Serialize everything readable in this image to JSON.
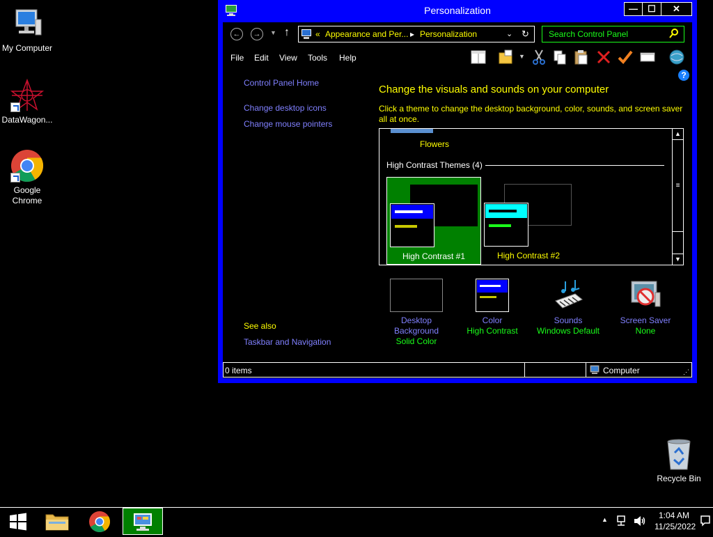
{
  "desktop": {
    "icons": [
      {
        "label": "My Computer"
      },
      {
        "label": "DataWagon..."
      },
      {
        "label": "Google Chrome"
      },
      {
        "label": "Recycle Bin"
      }
    ]
  },
  "window": {
    "title": "Personalization",
    "controls": {
      "minimize": "—",
      "maximize": "☐",
      "close": "✕"
    },
    "breadcrumb": {
      "prefix": "«",
      "parent": "Appearance and Per...",
      "separator": "▸",
      "current": "Personalization"
    },
    "search_placeholder": "Search Control Panel",
    "menu": [
      "File",
      "Edit",
      "View",
      "Tools",
      "Help"
    ],
    "left_links": [
      "Control Panel Home",
      "Change desktop icons",
      "Change mouse pointers"
    ],
    "see_also": {
      "heading": "See also",
      "links": [
        "Taskbar and Navigation"
      ]
    },
    "heading": "Change the visuals and sounds on your computer",
    "subheading": "Click a theme to change the desktop background, color, sounds, and screen saver all at once.",
    "themes": {
      "prev_theme_label": "Flowers",
      "group_label": "High Contrast Themes (4)",
      "items": [
        {
          "label": "High Contrast #1",
          "selected": true
        },
        {
          "label": "High Contrast #2",
          "selected": false
        }
      ]
    },
    "settings": [
      {
        "title": "Desktop Background",
        "value": "Solid Color"
      },
      {
        "title": "Color",
        "value": "High Contrast"
      },
      {
        "title": "Sounds",
        "value": "Windows Default"
      },
      {
        "title": "Screen Saver",
        "value": "None"
      }
    ],
    "status": {
      "items": "0 items",
      "location": "Computer"
    }
  },
  "taskbar": {
    "time": "1:04 AM",
    "date": "11/25/2022"
  },
  "colors": {
    "window_frame": "#0000ff",
    "link": "#8080ff",
    "heading": "#ffff00",
    "value": "#1aff1a",
    "selected_theme": "#008000"
  }
}
